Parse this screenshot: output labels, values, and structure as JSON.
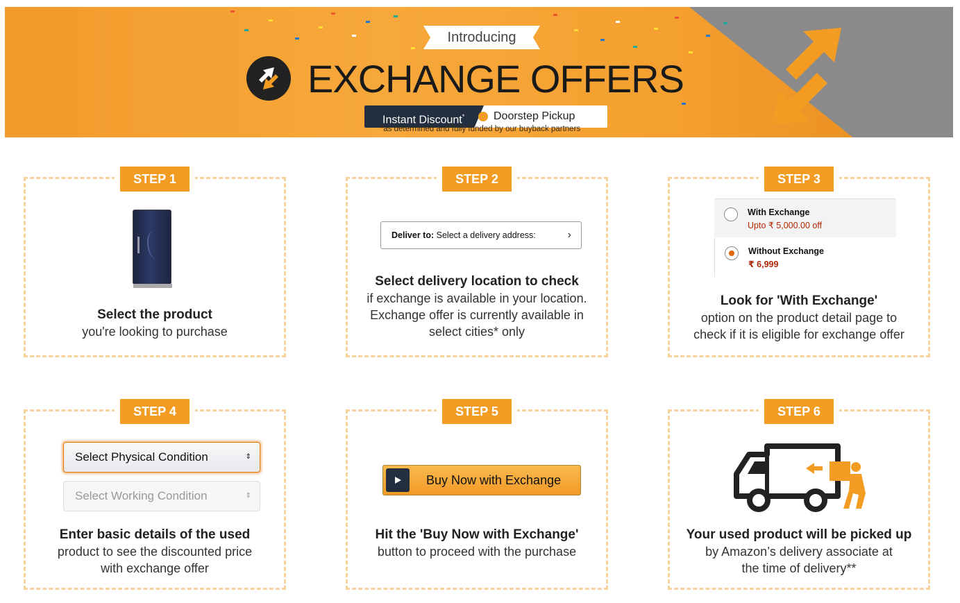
{
  "banner": {
    "intro": "Introducing",
    "title": "EXCHANGE OFFERS",
    "pill_left": "Instant Discount",
    "pill_left_mark": "*",
    "pill_right": "Doorstep Pickup",
    "disclaimer": "*as determined and fully funded by our buyback partners",
    "logo_icon": "exchange-arrows-icon",
    "colors": {
      "orange": "#f39c24",
      "dark": "#232f3e",
      "grey": "#8a8a8a"
    }
  },
  "steps": [
    {
      "tab": "STEP 1",
      "image_icon": "refrigerator-icon",
      "heading": "Select the product",
      "lines": [
        "you're looking to purchase"
      ]
    },
    {
      "tab": "STEP 2",
      "deliver_label": "Deliver to:",
      "deliver_text": "Select a delivery address:",
      "heading": "Select delivery location to check",
      "lines": [
        "if exchange is available in your location.",
        "Exchange offer is currently available in",
        "select cities* only"
      ]
    },
    {
      "tab": "STEP 3",
      "options": [
        {
          "title": "With Exchange",
          "price": "Upto ₹ 5,000.00 off",
          "selected": false
        },
        {
          "title": "Without Exchange",
          "price": "₹ 6,999",
          "selected": true
        }
      ],
      "heading": "Look for 'With Exchange'",
      "lines": [
        "option on the product detail page to",
        "check if it is eligible for exchange offer"
      ]
    },
    {
      "tab": "STEP 4",
      "select_physical": "Select Physical Condition",
      "select_working": "Select Working Condition",
      "heading": "Enter basic details of the used",
      "lines": [
        "product to see the discounted price",
        "with exchange offer"
      ]
    },
    {
      "tab": "STEP 5",
      "button_label": "Buy Now with Exchange",
      "heading": "Hit the 'Buy Now with Exchange'",
      "lines": [
        "button to proceed with the purchase"
      ]
    },
    {
      "tab": "STEP 6",
      "image_icon": "delivery-truck-icon",
      "heading": "Your used product will be picked up",
      "lines": [
        "by Amazon’s delivery associate at",
        "the time of delivery**"
      ]
    }
  ]
}
